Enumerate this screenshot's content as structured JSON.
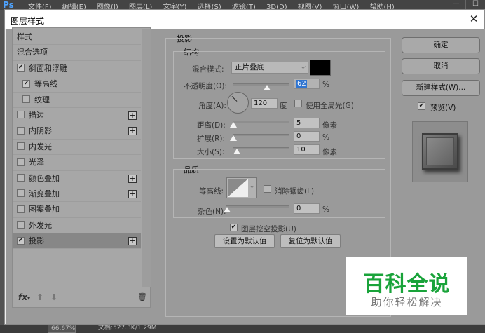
{
  "ps": {
    "logo": "Ps",
    "menus": "文件(F) 编辑(E) 图像(I) 图层(L) 文字(Y) 选择(S) 滤镜(T) 3D(D) 视图(V) 窗口(W) 帮助(H)",
    "win_min": "—",
    "win_max": "☐",
    "zoom": "66.67%",
    "doc_info": "文档:527.3K/1.29M"
  },
  "dialog": {
    "title": "图层样式",
    "close_glyph": "✕"
  },
  "left_panel": {
    "items": [
      {
        "label": "样式",
        "checkbox": false,
        "checked": false,
        "plus": false
      },
      {
        "label": "混合选项",
        "checkbox": false,
        "checked": false,
        "plus": false
      },
      {
        "label": "斜面和浮雕",
        "checkbox": true,
        "checked": true,
        "plus": false
      },
      {
        "label": "等高线",
        "checkbox": true,
        "checked": true,
        "plus": false,
        "sub": true
      },
      {
        "label": "纹理",
        "checkbox": true,
        "checked": false,
        "plus": false,
        "sub": true
      },
      {
        "label": "描边",
        "checkbox": true,
        "checked": false,
        "plus": true
      },
      {
        "label": "内阴影",
        "checkbox": true,
        "checked": false,
        "plus": true
      },
      {
        "label": "内发光",
        "checkbox": true,
        "checked": false,
        "plus": false
      },
      {
        "label": "光泽",
        "checkbox": true,
        "checked": false,
        "plus": false
      },
      {
        "label": "颜色叠加",
        "checkbox": true,
        "checked": false,
        "plus": true
      },
      {
        "label": "渐变叠加",
        "checkbox": true,
        "checked": false,
        "plus": true
      },
      {
        "label": "图案叠加",
        "checkbox": true,
        "checked": false,
        "plus": false
      },
      {
        "label": "外发光",
        "checkbox": true,
        "checked": false,
        "plus": false
      },
      {
        "label": "投影",
        "checkbox": true,
        "checked": true,
        "plus": true,
        "selected": true
      }
    ],
    "fx_label": "fx",
    "fx_caret": "▾",
    "up_glyph": "⬆",
    "down_glyph": "⬇",
    "trash_glyph": "🗑",
    "check_glyph": "✔",
    "plus_glyph": "+"
  },
  "shadow": {
    "section_title": "投影",
    "structure_title": "结构",
    "blend_mode_label": "混合模式:",
    "blend_mode_value": "正片叠底",
    "blend_color": "#000000",
    "opacity_label": "不透明度(O):",
    "opacity_value": "62",
    "opacity_unit": "%",
    "angle_label": "角度(A):",
    "angle_value": "120",
    "angle_unit": "度",
    "global_light_label": "使用全局光(G)",
    "global_light_checked": false,
    "distance_label": "距离(D):",
    "distance_value": "5",
    "distance_unit": "像素",
    "spread_label": "扩展(R):",
    "spread_value": "0",
    "spread_unit": "%",
    "size_label": "大小(S):",
    "size_value": "10",
    "size_unit": "像素",
    "quality_title": "品质",
    "contour_label": "等高线:",
    "anti_alias_label": "消除锯齿(L)",
    "anti_alias_checked": false,
    "noise_label": "杂色(N):",
    "noise_value": "0",
    "noise_unit": "%",
    "knockout_label": "图层挖空投影(U)",
    "knockout_checked": true,
    "make_default_label": "设置为默认值",
    "reset_default_label": "复位为默认值",
    "dropdown_arrow": "⌵"
  },
  "right": {
    "ok_label": "确定",
    "cancel_label": "取消",
    "new_style_label": "新建样式(W)...",
    "preview_label": "预览(V)",
    "preview_checked": true
  },
  "watermark": {
    "title": "百科全说",
    "subtitle": "助你轻松解决",
    "title_color": "#19a33a"
  }
}
